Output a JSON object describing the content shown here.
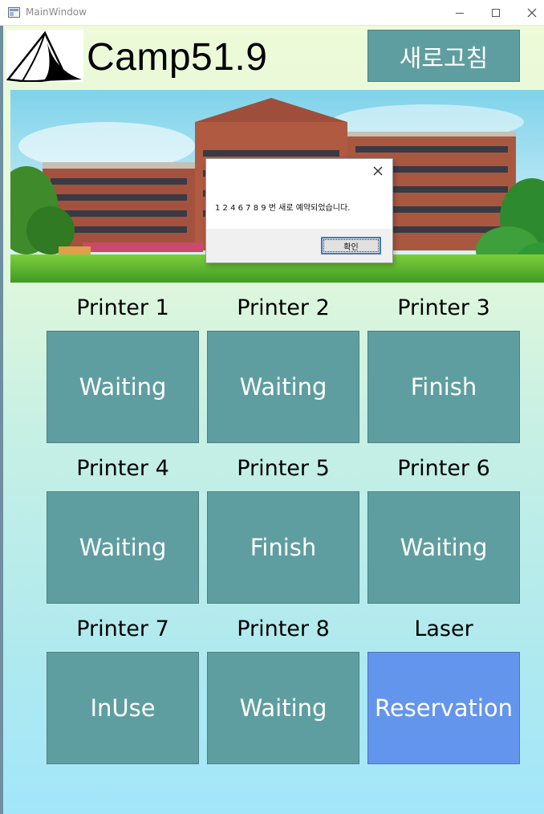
{
  "window": {
    "title": "MainWindow"
  },
  "header": {
    "app_title": "Camp51.9",
    "refresh_label": "새로고침"
  },
  "dialog": {
    "message": "1 2 4 6 7 8 9 번 새로 예약되었습니다.",
    "ok_label": "확인"
  },
  "colors": {
    "tile": "#5f9ea0",
    "tile_reservation": "#6495ed"
  },
  "devices": [
    {
      "name": "Printer 1",
      "status": "Waiting"
    },
    {
      "name": "Printer 2",
      "status": "Waiting"
    },
    {
      "name": "Printer 3",
      "status": "Finish"
    },
    {
      "name": "Printer 4",
      "status": "Waiting"
    },
    {
      "name": "Printer 5",
      "status": "Finish"
    },
    {
      "name": "Printer 6",
      "status": "Waiting"
    },
    {
      "name": "Printer 7",
      "status": "InUse"
    },
    {
      "name": "Printer 8",
      "status": "Waiting"
    },
    {
      "name": "Laser",
      "status": "Reservation"
    }
  ]
}
